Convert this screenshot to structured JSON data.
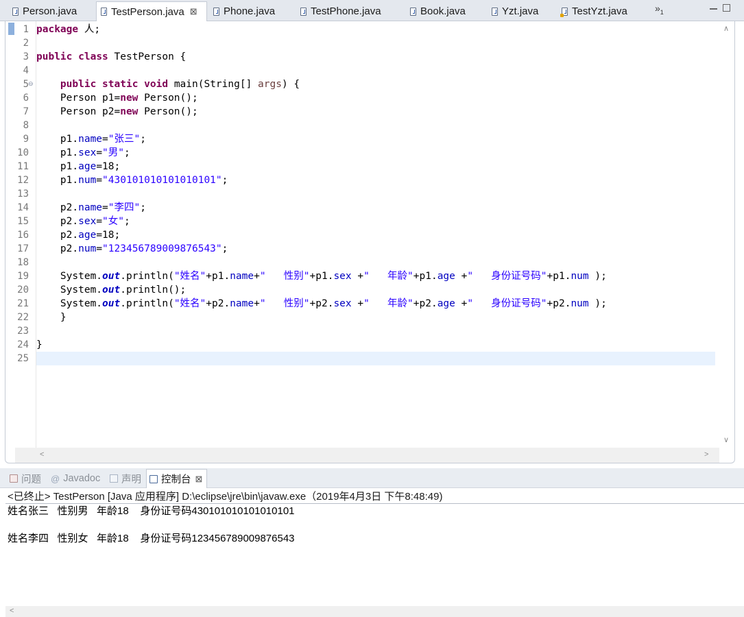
{
  "editor_tabs": [
    {
      "label": "Person.java",
      "icon": "java-file-icon"
    },
    {
      "label": "TestPerson.java",
      "icon": "java-file-icon",
      "active": true,
      "close": "⊠"
    },
    {
      "label": "Phone.java",
      "icon": "java-file-icon"
    },
    {
      "label": "TestPhone.java",
      "icon": "java-file-icon"
    },
    {
      "label": "Book.java",
      "icon": "java-file-icon"
    },
    {
      "label": "Yzt.java",
      "icon": "java-file-icon"
    },
    {
      "label": "TestYzt.java",
      "icon": "java-warning-file-icon"
    }
  ],
  "tab_overflow": {
    "glyph": "»",
    "count": "1"
  },
  "code": {
    "line_numbers": [
      "1",
      "2",
      "3",
      "4",
      "5",
      "6",
      "7",
      "8",
      "9",
      "10",
      "11",
      "12",
      "13",
      "14",
      "15",
      "16",
      "17",
      "18",
      "19",
      "20",
      "21",
      "22",
      "23",
      "24",
      "25"
    ],
    "current_line": "25",
    "lines": [
      [
        {
          "t": "package",
          "c": "kw"
        },
        {
          "t": " 人;"
        }
      ],
      [],
      [
        {
          "t": "public",
          "c": "kw"
        },
        {
          "t": " "
        },
        {
          "t": "class",
          "c": "kw"
        },
        {
          "t": " TestPerson {"
        }
      ],
      [],
      [
        {
          "t": "    "
        },
        {
          "t": "public",
          "c": "kw"
        },
        {
          "t": " "
        },
        {
          "t": "static",
          "c": "kw"
        },
        {
          "t": " "
        },
        {
          "t": "void",
          "c": "kw"
        },
        {
          "t": " main(String[] "
        },
        {
          "t": "args",
          "c": "pm"
        },
        {
          "t": ") {"
        }
      ],
      [
        {
          "t": "    Person p1="
        },
        {
          "t": "new",
          "c": "kw"
        },
        {
          "t": " Person();"
        }
      ],
      [
        {
          "t": "    Person p2="
        },
        {
          "t": "new",
          "c": "kw"
        },
        {
          "t": " Person();"
        }
      ],
      [],
      [
        {
          "t": "    p1."
        },
        {
          "t": "name",
          "c": "fd"
        },
        {
          "t": "="
        },
        {
          "t": "\"张三\"",
          "c": "st"
        },
        {
          "t": ";"
        }
      ],
      [
        {
          "t": "    p1."
        },
        {
          "t": "sex",
          "c": "fd"
        },
        {
          "t": "="
        },
        {
          "t": "\"男\"",
          "c": "st"
        },
        {
          "t": ";"
        }
      ],
      [
        {
          "t": "    p1."
        },
        {
          "t": "age",
          "c": "fd"
        },
        {
          "t": "=18;"
        }
      ],
      [
        {
          "t": "    p1."
        },
        {
          "t": "num",
          "c": "fd"
        },
        {
          "t": "="
        },
        {
          "t": "\"430101010101010101\"",
          "c": "st"
        },
        {
          "t": ";"
        }
      ],
      [],
      [
        {
          "t": "    p2."
        },
        {
          "t": "name",
          "c": "fd"
        },
        {
          "t": "="
        },
        {
          "t": "\"李四\"",
          "c": "st"
        },
        {
          "t": ";"
        }
      ],
      [
        {
          "t": "    p2."
        },
        {
          "t": "sex",
          "c": "fd"
        },
        {
          "t": "="
        },
        {
          "t": "\"女\"",
          "c": "st"
        },
        {
          "t": ";"
        }
      ],
      [
        {
          "t": "    p2."
        },
        {
          "t": "age",
          "c": "fd"
        },
        {
          "t": "=18;"
        }
      ],
      [
        {
          "t": "    p2."
        },
        {
          "t": "num",
          "c": "fd"
        },
        {
          "t": "="
        },
        {
          "t": "\"123456789009876543\"",
          "c": "st"
        },
        {
          "t": ";"
        }
      ],
      [],
      [
        {
          "t": "    System."
        },
        {
          "t": "out",
          "c": "sf"
        },
        {
          "t": ".println("
        },
        {
          "t": "\"姓名\"",
          "c": "st"
        },
        {
          "t": "+p1."
        },
        {
          "t": "name",
          "c": "fd"
        },
        {
          "t": "+"
        },
        {
          "t": "\"   性别\"",
          "c": "st"
        },
        {
          "t": "+p1."
        },
        {
          "t": "sex",
          "c": "fd"
        },
        {
          "t": " +"
        },
        {
          "t": "\"   年龄\"",
          "c": "st"
        },
        {
          "t": "+p1."
        },
        {
          "t": "age",
          "c": "fd"
        },
        {
          "t": " +"
        },
        {
          "t": "\"   身份证号码\"",
          "c": "st"
        },
        {
          "t": "+p1."
        },
        {
          "t": "num",
          "c": "fd"
        },
        {
          "t": " );"
        }
      ],
      [
        {
          "t": "    System."
        },
        {
          "t": "out",
          "c": "sf"
        },
        {
          "t": ".println();"
        }
      ],
      [
        {
          "t": "    System."
        },
        {
          "t": "out",
          "c": "sf"
        },
        {
          "t": ".println("
        },
        {
          "t": "\"姓名\"",
          "c": "st"
        },
        {
          "t": "+p2."
        },
        {
          "t": "name",
          "c": "fd"
        },
        {
          "t": "+"
        },
        {
          "t": "\"   性别\"",
          "c": "st"
        },
        {
          "t": "+p2."
        },
        {
          "t": "sex",
          "c": "fd"
        },
        {
          "t": " +"
        },
        {
          "t": "\"   年龄\"",
          "c": "st"
        },
        {
          "t": "+p2."
        },
        {
          "t": "age",
          "c": "fd"
        },
        {
          "t": " +"
        },
        {
          "t": "\"   身份证号码\"",
          "c": "st"
        },
        {
          "t": "+p2."
        },
        {
          "t": "num",
          "c": "fd"
        },
        {
          "t": " );"
        }
      ],
      [
        {
          "t": "    }"
        }
      ],
      [],
      [
        {
          "t": "}"
        }
      ],
      []
    ]
  },
  "panel_tabs": [
    {
      "label": "问题",
      "icon": "problems-icon"
    },
    {
      "label": "Javadoc",
      "icon": "javadoc-icon",
      "glyph": "@"
    },
    {
      "label": "声明",
      "icon": "declaration-icon"
    },
    {
      "label": "控制台",
      "icon": "console-icon",
      "active": true,
      "close": "⊠"
    }
  ],
  "console": {
    "header": "<已终止> TestPerson [Java 应用程序] D:\\eclipse\\jre\\bin\\javaw.exe（2019年4月3日 下午8:48:49)",
    "lines": [
      "姓名张三   性别男   年龄18    身份证号码430101010101010101",
      "",
      "姓名李四   性别女   年龄18    身份证号码123456789009876543"
    ]
  },
  "scroll_glyphs": {
    "up": "∧",
    "down": "∨",
    "left": "<",
    "right": ">"
  }
}
